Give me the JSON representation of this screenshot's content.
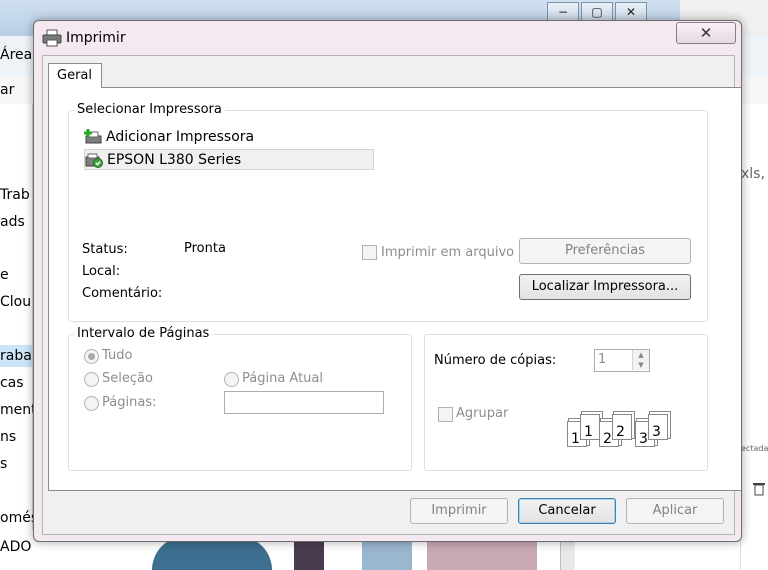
{
  "background": {
    "nav_items": [
      "Área",
      "ar",
      "Trab",
      "ads",
      "e",
      "Clou",
      "rabal",
      "cas",
      "mento",
      "ns",
      "s",
      "omés",
      "ADO POR DEUS"
    ],
    "right_fragments": [
      "xls,",
      "ectada"
    ],
    "caption_buttons": [
      "−",
      "▢",
      "✕"
    ]
  },
  "dialog": {
    "title": "Imprimir",
    "close_label": "✕",
    "tab_label": "Geral",
    "select_printer": {
      "group_label": "Selecionar Impressora",
      "printers": [
        {
          "name": "Adicionar Impressora",
          "icon": "add-printer-icon"
        },
        {
          "name": "EPSON L380 Series",
          "icon": "printer-default-icon",
          "selected": true
        }
      ],
      "status_label": "Status:",
      "status_value": "Pronta",
      "location_label": "Local:",
      "comment_label": "Comentário:",
      "print_to_file_label": "Imprimir em arquivo",
      "preferences_label": "Preferências",
      "find_printer_label": "Localizar Impressora..."
    },
    "page_range": {
      "group_label": "Intervalo de Páginas",
      "all_label": "Tudo",
      "selection_label": "Seleção",
      "current_page_label": "Página Atual",
      "pages_label": "Páginas:",
      "pages_value": "",
      "selected": "Tudo"
    },
    "copies": {
      "label": "Número de cópias:",
      "value": "1",
      "collate_label": "Agrupar",
      "collate_pages": [
        "1",
        "1",
        "2",
        "2",
        "3",
        "3"
      ]
    },
    "buttons": {
      "print": "Imprimir",
      "cancel": "Cancelar",
      "apply": "Aplicar"
    }
  }
}
